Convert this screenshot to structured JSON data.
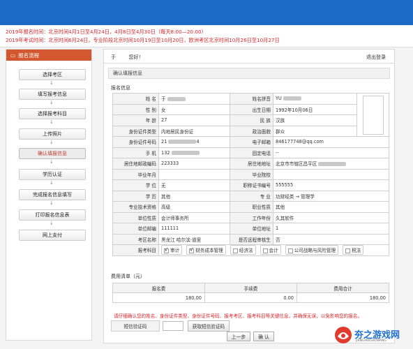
{
  "notices": {
    "line1": "2019年报名时间：北京时间4月1日至4月24日，4月8日至4月30日（每天8:00—20:00）",
    "line2": "2019年考试时间：北京时间6月24日，专业阶段北京时间10月19日至10月20日，欧洲考区北京时间10月26日至10月27日"
  },
  "sidebar": {
    "header": "报名流程",
    "items": [
      {
        "label": "选择考区"
      },
      {
        "label": "填写报考信息"
      },
      {
        "label": "选择报考科目"
      },
      {
        "label": "上传照片"
      },
      {
        "label": "确认填报信息"
      },
      {
        "label": "学历认证"
      },
      {
        "label": "完成报名信息填写"
      },
      {
        "label": "打印报名信息表"
      },
      {
        "label": "网上支付"
      }
    ],
    "arrow": "↓"
  },
  "header": {
    "greeting": "于 　　 您好！",
    "logout": "退出登录",
    "breadcrumb": "确认填报信息"
  },
  "section": {
    "title": "报名信息"
  },
  "info": {
    "name_label": "姓 名",
    "name_value": "于",
    "pinyin_label": "姓名拼音",
    "pinyin_value": "YU",
    "gender_label": "性 别",
    "gender_value": "女",
    "birth_label": "出生日期",
    "birth_value": "1992年10月06日",
    "age_label": "年 龄",
    "age_value": "27",
    "ethnic_label": "民 族",
    "ethnic_value": "汉族",
    "idtype_label": "身份证件类型",
    "idtype_value": "内地居民身份证",
    "politics_label": "政治面貌",
    "politics_value": "群众",
    "idno_label": "身份证件号码",
    "idno_value": "21",
    "idno_tail": "4",
    "email_label": "电子邮箱",
    "email_value": "846177748@qq.com",
    "mobile_label": "手 机",
    "mobile_value": "132",
    "phone_label": "固定电话",
    "phone_value": "--",
    "postcode_label": "居住地邮政编码",
    "postcode_value": "223333",
    "address_label": "居住地地址",
    "address_value": "北京市市辖区昌平区",
    "gradyear_label": "毕业年月",
    "gradyear_value": "",
    "school_label": "毕业院校",
    "school_value": "",
    "degree_label": "学 位",
    "degree_value": "无",
    "cert_label": "职称证书编号",
    "cert_value": "555555",
    "education_label": "学 历",
    "education_value": "其他",
    "major_label": "专 业",
    "major_value": "功财经类 → 管理学",
    "title_label": "专业技术资格",
    "title_value": "高级",
    "position_label": "职业性质",
    "position_value": "其他",
    "unittype_label": "单位性质",
    "unittype_value": "会计师事务所",
    "worktime_label": "工作年份",
    "worktime_value": "久其软件",
    "unitphone_label": "单位邮编",
    "unitphone_value": "111111",
    "unitaddr_label": "单位地址",
    "unitaddr_value": "1",
    "area_label": "考区名称",
    "area_value": "黑龙江 哈尔滨-道里",
    "remote_label": "是否远程审核生",
    "remote_value": "否",
    "subjects_label": "报考科目",
    "subjects": [
      {
        "label": "审计",
        "checked": true
      },
      {
        "label": "财务成本管理",
        "checked": true
      },
      {
        "label": "经济法",
        "checked": false
      },
      {
        "label": "会计",
        "checked": false
      },
      {
        "label": "公司战略与风险管理",
        "checked": false
      },
      {
        "label": "税法",
        "checked": false
      }
    ]
  },
  "fees": {
    "title": "费用清单（元）",
    "headers": [
      "报名费",
      "手续费",
      "费用合计"
    ],
    "values": [
      "180.00",
      "0.00",
      "180.00"
    ]
  },
  "warning": "请仔细确认您的姓名、身份证件类型、身份证件号码、报考考区、报考科目等关键信息，并确保无误，以免影响您的报名。",
  "sms": {
    "label": "短信验证码",
    "button": "获取短信验证码"
  },
  "buttons": {
    "prev": "上一步",
    "confirm": "确 认"
  },
  "watermark": {
    "text": "夯之游戏网",
    "sub": "JIANGHUGUOWANG"
  },
  "colors": {
    "topbar": "#1a6ac6",
    "notice": "#d9262b",
    "sidebar_header": "#d4582f"
  }
}
